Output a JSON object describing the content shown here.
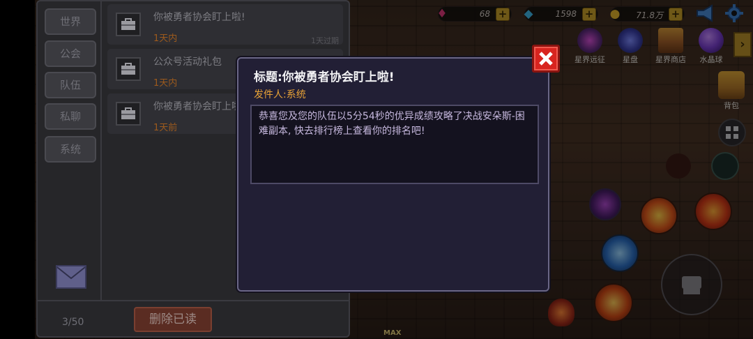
{
  "resources": [
    {
      "icon": "pink-gem-icon",
      "value": "68"
    },
    {
      "icon": "blue-diamond-icon",
      "value": "1598"
    },
    {
      "icon": "gold-coin-icon",
      "value": "71.8万"
    }
  ],
  "shop_icons": [
    {
      "label": "星界远征"
    },
    {
      "label": "星盘"
    },
    {
      "label": "星界商店"
    },
    {
      "label": "水晶球"
    }
  ],
  "backpack_label": "背包",
  "max_label": "MAX",
  "chat": {
    "tabs": [
      "世界",
      "公会",
      "队伍",
      "私聊",
      "系统"
    ],
    "mails": [
      {
        "title": "你被勇者协会盯上啦!",
        "age": "1天内",
        "expiry": "1天过期"
      },
      {
        "title": "公众号活动礼包",
        "age": "1天内",
        "expiry": ""
      },
      {
        "title": "你被勇者协会盯上啦!",
        "age": "1天前",
        "expiry": ""
      }
    ],
    "count": "3/50",
    "delete_read_label": "删除已读"
  },
  "mail_detail": {
    "title": "标题:你被勇者协会盯上啦!",
    "sender": "发件人:系统",
    "body": "恭喜您及您的队伍以5分54秒的优异成绩攻略了决战安朵斯-困难副本, 快去排行榜上查看你的排名吧!"
  },
  "colors": {
    "modal_bg": "#221f35",
    "sender_text": "#e8a236",
    "close_button": "#d8241f",
    "delete_button": "#5a2c22"
  }
}
